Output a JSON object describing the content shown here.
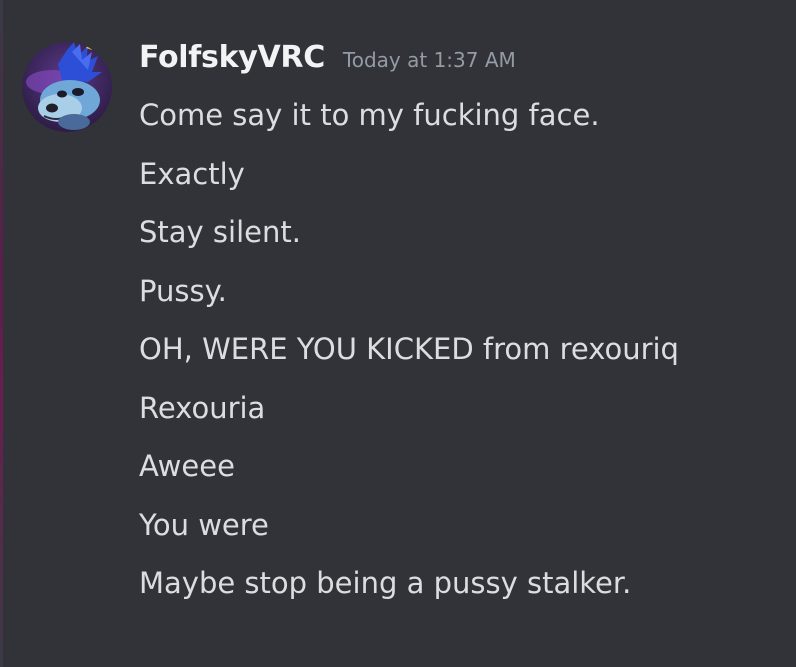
{
  "author": {
    "username": "FolfskyVRC",
    "timestamp": "Today at 1:37 AM",
    "avatar_icon": "wolf-avatar-icon"
  },
  "messages": [
    "Come say it to my fucking face.",
    "Exactly",
    "Stay silent.",
    "Pussy.",
    "OH, WERE YOU KICKED from rexouriq",
    "Rexouria",
    "Aweee",
    "You were",
    "Maybe stop being a pussy stalker."
  ],
  "colors": {
    "background": "#313338",
    "username": "#f2f3f5",
    "timestamp": "#949ba4",
    "message_text": "#dbdee1"
  }
}
